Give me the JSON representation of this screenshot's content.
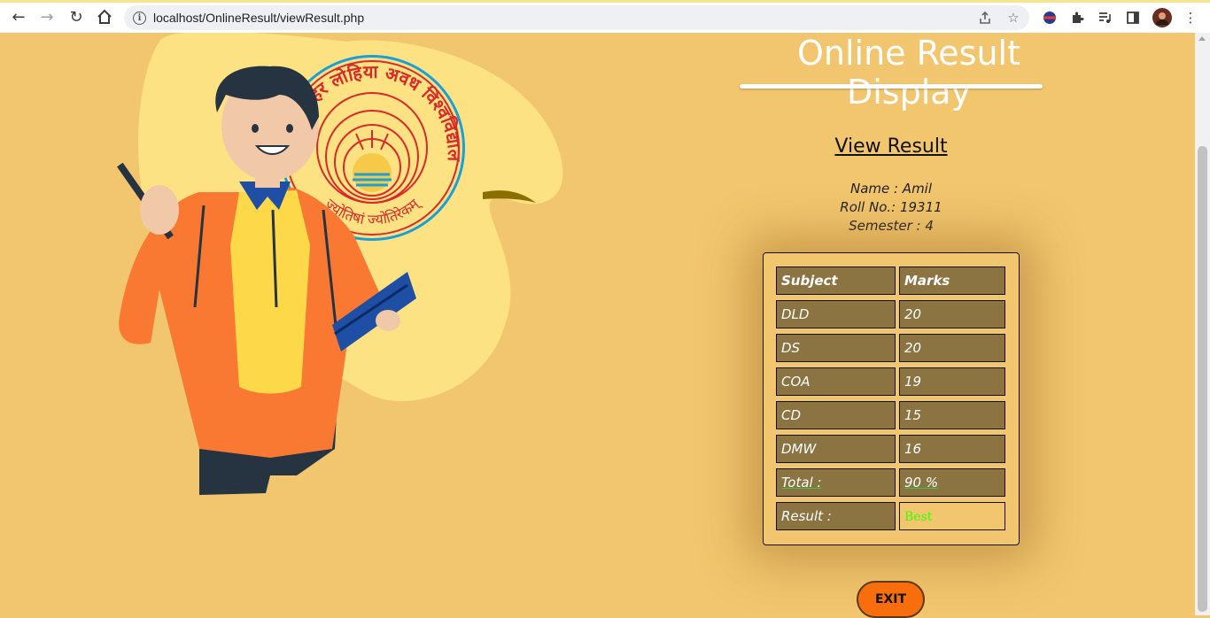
{
  "browser": {
    "url": "localhost/OnlineResult/viewResult.php"
  },
  "page": {
    "heading": "Online Result Display",
    "view_result_link": "View Result",
    "student": {
      "name_line": "Name : Amil",
      "roll_line": "Roll No.: 19311",
      "semester_line": "Semester : 4"
    },
    "emblem_text": "डॉ. राममनोहर लोहिया अवध विश्वविद्यालय",
    "emblem_motto": "ज्योतिषां ज्योतिरेकम्",
    "table": {
      "headers": [
        "Subject",
        "Marks"
      ],
      "rows": [
        {
          "subject": "DLD",
          "marks": "20"
        },
        {
          "subject": "DS",
          "marks": "20"
        },
        {
          "subject": "COA",
          "marks": "19"
        },
        {
          "subject": "CD",
          "marks": "15"
        },
        {
          "subject": "DMW",
          "marks": "16"
        }
      ],
      "total_label": "Total :",
      "total_value": "90 %",
      "result_label": "Result :",
      "result_value": "Best"
    },
    "exit_label": "EXIT"
  },
  "colors": {
    "page_bg": "#f2c66e",
    "cell_bg": "#8b7342",
    "exit_bg": "#f96e0c",
    "best_text": "#3bff00"
  }
}
